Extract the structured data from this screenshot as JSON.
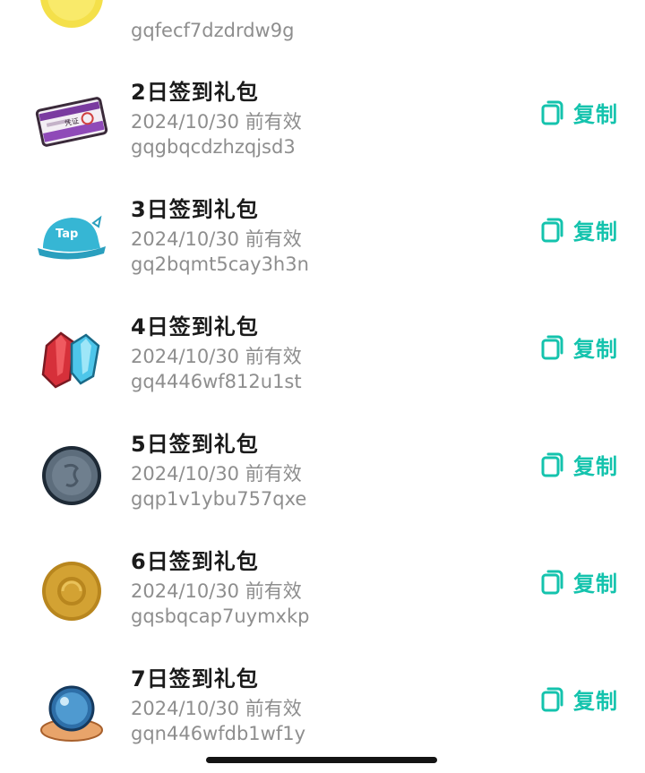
{
  "partial_top_item": {
    "code": "gqfecf7dzdrdw9g",
    "icon": "gold-coin-icon"
  },
  "items": [
    {
      "title": "2日签到礼包",
      "expiry": "2024/10/30 前有效",
      "code": "gqgbqcdzhzqjsd3",
      "icon": "voucher-ticket-icon",
      "ticket_text": "凭证"
    },
    {
      "title": "3日签到礼包",
      "expiry": "2024/10/30 前有效",
      "code": "gq2bqmt5cay3h3n",
      "icon": "tap-cap-icon",
      "cap_text": "Tap"
    },
    {
      "title": "4日签到礼包",
      "expiry": "2024/10/30 前有效",
      "code": "gq4446wf812u1st",
      "icon": "crystals-icon"
    },
    {
      "title": "5日签到礼包",
      "expiry": "2024/10/30 前有效",
      "code": "gqp1v1ybu757qxe",
      "icon": "silver-coin-icon"
    },
    {
      "title": "6日签到礼包",
      "expiry": "2024/10/30 前有效",
      "code": "gqsbqcap7uymxkp",
      "icon": "bronze-coin-icon"
    },
    {
      "title": "7日签到礼包",
      "expiry": "2024/10/30 前有效",
      "code": "gqn446wfdb1wf1y",
      "icon": "crystal-ball-icon"
    }
  ],
  "copy_label": "复制",
  "colors": {
    "accent": "#14c3ad",
    "title": "#1b1b1b",
    "secondary": "#8e8e8e"
  }
}
